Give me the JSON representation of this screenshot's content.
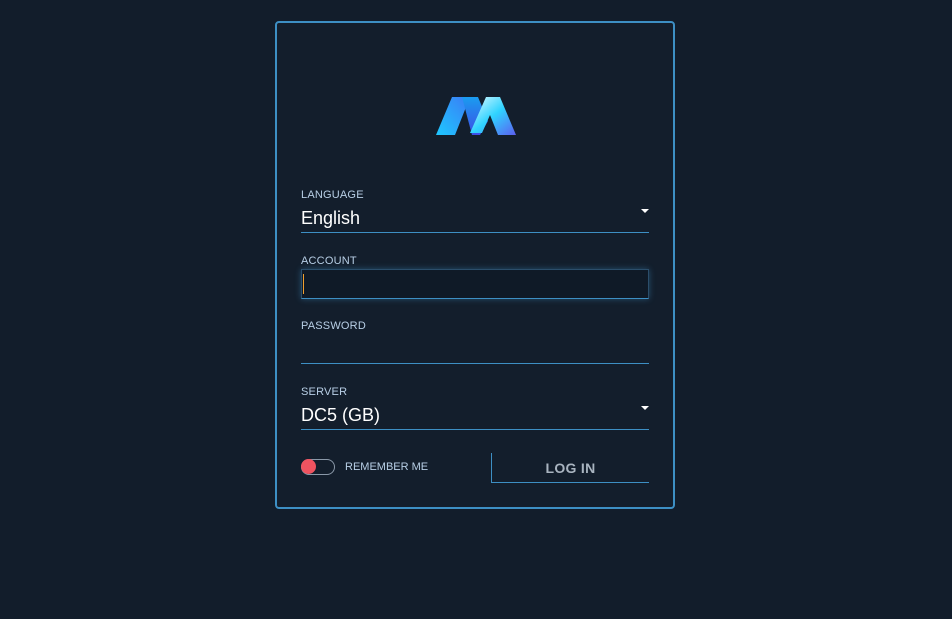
{
  "logo": {
    "icon": "brand-m-logo",
    "gradient_start": "#22c2ff",
    "gradient_end": "#5b5ef0"
  },
  "form": {
    "language": {
      "label": "LANGUAGE",
      "value": "English",
      "icon": "caret-down-icon"
    },
    "account": {
      "label": "ACCOUNT",
      "value": ""
    },
    "password": {
      "label": "PASSWORD",
      "value": ""
    },
    "server": {
      "label": "SERVER",
      "value": "DC5 (GB)",
      "icon": "caret-down-icon"
    },
    "remember": {
      "label": "REMEMBER ME",
      "checked": false,
      "knob_color": "#ef5360"
    },
    "login_label": "LOG IN"
  },
  "colors": {
    "background": "#121d2b",
    "accent_border": "#3d8fc4",
    "label_text": "#b8cfe6",
    "value_text": "#ffffff",
    "button_text": "#a9b4c0"
  }
}
